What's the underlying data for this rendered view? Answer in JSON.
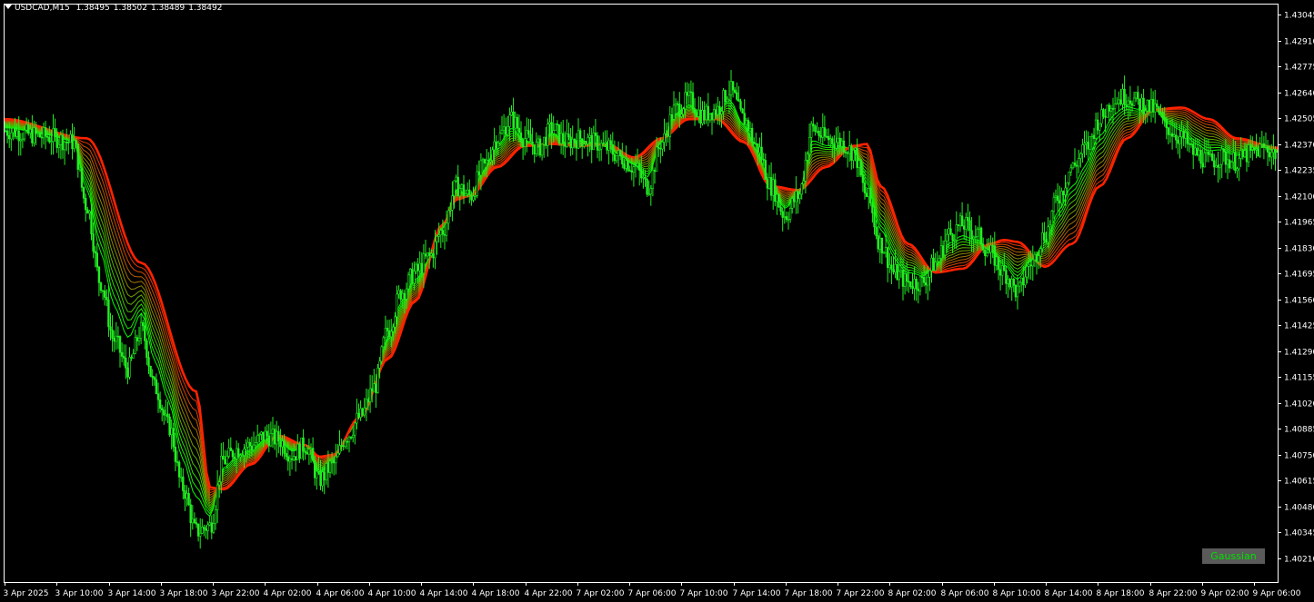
{
  "header": {
    "symbol": "USDCAD,M15",
    "open": "1.38495",
    "high": "1.38502",
    "low": "1.38489",
    "close": "1.38492"
  },
  "indicator_badge": "Gaussian",
  "colors": {
    "background": "#000000",
    "frame": "#ffffff",
    "candle": "#22ee22",
    "band_start": "#00ff00",
    "band_end": "#ff2200"
  },
  "chart_data": {
    "type": "candlestick",
    "symbol": "USDCAD",
    "timeframe": "M15",
    "y_ticks": [
      "1.43045",
      "1.42910",
      "1.42775",
      "1.42640",
      "1.42505",
      "1.42370",
      "1.42235",
      "1.42100",
      "1.41965",
      "1.41830",
      "1.41695",
      "1.41560",
      "1.41425",
      "1.41290",
      "1.41155",
      "1.41020",
      "1.40885",
      "1.40750",
      "1.40615",
      "1.40480",
      "1.40345",
      "1.40210"
    ],
    "ylim": [
      1.4021,
      1.43045
    ],
    "x_ticks": [
      "3 Apr 2025",
      "3 Apr 10:00",
      "3 Apr 14:00",
      "3 Apr 18:00",
      "3 Apr 22:00",
      "4 Apr 02:00",
      "4 Apr 06:00",
      "4 Apr 10:00",
      "4 Apr 14:00",
      "4 Apr 18:00",
      "4 Apr 22:00",
      "7 Apr 02:00",
      "7 Apr 06:00",
      "7 Apr 10:00",
      "7 Apr 14:00",
      "7 Apr 18:00",
      "7 Apr 22:00",
      "8 Apr 02:00",
      "8 Apr 06:00",
      "8 Apr 10:00",
      "8 Apr 14:00",
      "8 Apr 18:00",
      "8 Apr 22:00",
      "9 Apr 02:00",
      "9 Apr 06:00"
    ],
    "price_path": [
      [
        0,
        1.4244
      ],
      [
        3,
        1.4241
      ],
      [
        5,
        1.4238
      ],
      [
        6,
        1.4205
      ],
      [
        7,
        1.4165
      ],
      [
        8,
        1.4135
      ],
      [
        9,
        1.412
      ],
      [
        10,
        1.414
      ],
      [
        11,
        1.411
      ],
      [
        12,
        1.409
      ],
      [
        13,
        1.4058
      ],
      [
        14,
        1.4035
      ],
      [
        15,
        1.4038
      ],
      [
        16,
        1.4072
      ],
      [
        17,
        1.4078
      ],
      [
        18,
        1.408
      ],
      [
        19,
        1.4085
      ],
      [
        20,
        1.4083
      ],
      [
        21,
        1.4075
      ],
      [
        22,
        1.408
      ],
      [
        23,
        1.4062
      ],
      [
        24,
        1.407
      ],
      [
        25,
        1.4085
      ],
      [
        26,
        1.4095
      ],
      [
        27,
        1.411
      ],
      [
        28,
        1.414
      ],
      [
        29,
        1.416
      ],
      [
        30,
        1.417
      ],
      [
        31,
        1.4178
      ],
      [
        32,
        1.4192
      ],
      [
        33,
        1.4215
      ],
      [
        34,
        1.421
      ],
      [
        35,
        1.4225
      ],
      [
        36,
        1.424
      ],
      [
        37,
        1.425
      ],
      [
        38,
        1.424
      ],
      [
        39,
        1.4235
      ],
      [
        40,
        1.4245
      ],
      [
        41,
        1.4238
      ],
      [
        42,
        1.424
      ],
      [
        43,
        1.4238
      ],
      [
        44,
        1.4235
      ],
      [
        45,
        1.423
      ],
      [
        46,
        1.4225
      ],
      [
        47,
        1.4215
      ],
      [
        48,
        1.4238
      ],
      [
        49,
        1.4255
      ],
      [
        50,
        1.426
      ],
      [
        51,
        1.4252
      ],
      [
        52,
        1.4255
      ],
      [
        53,
        1.4265
      ],
      [
        54,
        1.425
      ],
      [
        55,
        1.4235
      ],
      [
        56,
        1.4215
      ],
      [
        57,
        1.42
      ],
      [
        58,
        1.421
      ],
      [
        59,
        1.4245
      ],
      [
        60,
        1.424
      ],
      [
        61,
        1.4238
      ],
      [
        62,
        1.4233
      ],
      [
        63,
        1.421
      ],
      [
        64,
        1.4185
      ],
      [
        65,
        1.417
      ],
      [
        66,
        1.4165
      ],
      [
        67,
        1.4165
      ],
      [
        68,
        1.4175
      ],
      [
        69,
        1.419
      ],
      [
        70,
        1.4195
      ],
      [
        71,
        1.419
      ],
      [
        72,
        1.418
      ],
      [
        73,
        1.417
      ],
      [
        74,
        1.416
      ],
      [
        75,
        1.4175
      ],
      [
        76,
        1.419
      ],
      [
        77,
        1.421
      ],
      [
        78,
        1.4225
      ],
      [
        79,
        1.4235
      ],
      [
        80,
        1.425
      ],
      [
        81,
        1.426
      ],
      [
        82,
        1.4262
      ],
      [
        83,
        1.4258
      ],
      [
        84,
        1.4255
      ],
      [
        85,
        1.4245
      ],
      [
        86,
        1.424
      ],
      [
        87,
        1.4232
      ],
      [
        88,
        1.4228
      ],
      [
        89,
        1.423
      ],
      [
        90,
        1.4228
      ],
      [
        91,
        1.4232
      ],
      [
        92,
        1.4235
      ],
      [
        93,
        1.4232
      ]
    ],
    "gaussian_band": {
      "count": 12,
      "slowest": [
        [
          0,
          1.425
        ],
        [
          6,
          1.424
        ],
        [
          10,
          1.4175
        ],
        [
          14,
          1.4108
        ],
        [
          15,
          1.4058
        ],
        [
          16,
          1.4057
        ],
        [
          18,
          1.407
        ],
        [
          20,
          1.4085
        ],
        [
          22,
          1.408
        ],
        [
          23,
          1.4074
        ],
        [
          24,
          1.4075
        ],
        [
          26,
          1.4095
        ],
        [
          28,
          1.4125
        ],
        [
          30,
          1.4155
        ],
        [
          32,
          1.4195
        ],
        [
          33,
          1.4208
        ],
        [
          34,
          1.421
        ],
        [
          36,
          1.4225
        ],
        [
          38,
          1.4236
        ],
        [
          40,
          1.4237
        ],
        [
          42,
          1.4236
        ],
        [
          44,
          1.4237
        ],
        [
          46,
          1.423
        ],
        [
          48,
          1.424
        ],
        [
          50,
          1.425
        ],
        [
          52,
          1.425
        ],
        [
          54,
          1.4238
        ],
        [
          56,
          1.4215
        ],
        [
          58,
          1.4213
        ],
        [
          60,
          1.4225
        ],
        [
          62,
          1.4236
        ],
        [
          63,
          1.4237
        ],
        [
          64,
          1.4215
        ],
        [
          66,
          1.4185
        ],
        [
          68,
          1.417
        ],
        [
          70,
          1.4172
        ],
        [
          72,
          1.4185
        ],
        [
          73,
          1.4187
        ],
        [
          74,
          1.4186
        ],
        [
          76,
          1.4173
        ],
        [
          78,
          1.4185
        ],
        [
          80,
          1.4215
        ],
        [
          82,
          1.424
        ],
        [
          84,
          1.4255
        ],
        [
          86,
          1.4256
        ],
        [
          88,
          1.425
        ],
        [
          90,
          1.424
        ],
        [
          93,
          1.4235
        ]
      ]
    },
    "grid": false
  }
}
